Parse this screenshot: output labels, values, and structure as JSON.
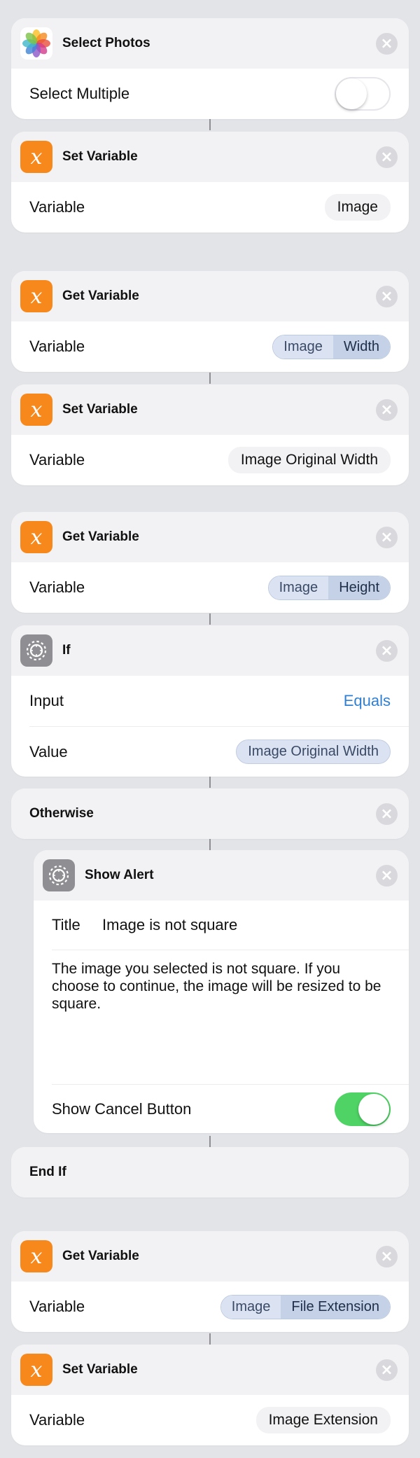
{
  "actions": {
    "select_photos": {
      "title": "Select Photos",
      "row_label": "Select Multiple",
      "select_multiple": false
    },
    "set_var_1": {
      "title": "Set Variable",
      "row_label": "Variable",
      "value": "Image"
    },
    "get_var_1": {
      "title": "Get Variable",
      "row_label": "Variable",
      "var": "Image",
      "prop": "Width"
    },
    "set_var_2": {
      "title": "Set Variable",
      "row_label": "Variable",
      "value": "Image Original Width"
    },
    "get_var_2": {
      "title": "Get Variable",
      "row_label": "Variable",
      "var": "Image",
      "prop": "Height"
    },
    "if": {
      "title": "If",
      "input_label": "Input",
      "input_value": "Equals",
      "value_label": "Value",
      "value": "Image Original Width"
    },
    "otherwise": {
      "title": "Otherwise"
    },
    "show_alert": {
      "title": "Show Alert",
      "title_label": "Title",
      "title_value": "Image is not square",
      "message": "The image you selected is not square. If you choose to continue, the image will be resized to be square.",
      "cancel_label": "Show Cancel Button",
      "show_cancel": true
    },
    "end_if": {
      "title": "End If"
    },
    "get_var_3": {
      "title": "Get Variable",
      "row_label": "Variable",
      "var": "Image",
      "prop": "File Extension"
    },
    "set_var_3": {
      "title": "Set Variable",
      "row_label": "Variable",
      "value": "Image Extension"
    }
  },
  "icons": {
    "remove": "close-icon",
    "variable": "variable-x-icon",
    "settings": "gear-icon",
    "photos": "photos-app-icon"
  },
  "colors": {
    "accent_orange": "#f7891c",
    "toggle_on": "#4fd365",
    "link_blue": "#2f7fd4"
  }
}
